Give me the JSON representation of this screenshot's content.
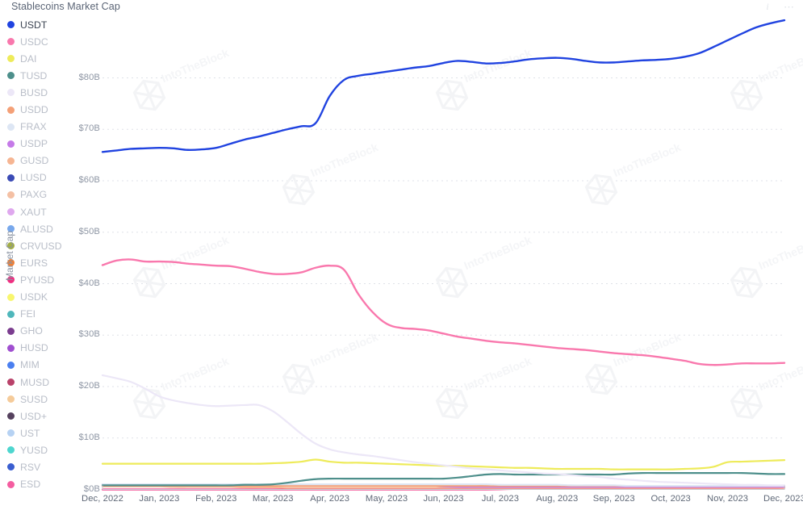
{
  "header": {
    "title": "Stablecoins Market Cap",
    "info_icon": "info-icon",
    "more_icon": "more-options-icon",
    "more_label": "⋯",
    "info_label": "i"
  },
  "watermark": {
    "text": "IntoTheBlock"
  },
  "legend": {
    "items": [
      {
        "label": "USDT",
        "color": "#2043e0",
        "active": true
      },
      {
        "label": "USDC",
        "color": "#f978ad",
        "active": false
      },
      {
        "label": "DAI",
        "color": "#eeeb5a",
        "active": false
      },
      {
        "label": "TUSD",
        "color": "#4d8f8b",
        "active": false
      },
      {
        "label": "BUSD",
        "color": "#ece7f7",
        "active": false
      },
      {
        "label": "USDD",
        "color": "#f4a077",
        "active": false
      },
      {
        "label": "FRAX",
        "color": "#dde6f4",
        "active": false
      },
      {
        "label": "USDP",
        "color": "#c57ae8",
        "active": false
      },
      {
        "label": "GUSD",
        "color": "#f6b592",
        "active": false
      },
      {
        "label": "LUSD",
        "color": "#3b4bb5",
        "active": false
      },
      {
        "label": "PAXG",
        "color": "#f4c0a4",
        "active": false
      },
      {
        "label": "XAUT",
        "color": "#dfa8ee",
        "active": false
      },
      {
        "label": "ALUSD",
        "color": "#78a8ec",
        "active": false
      },
      {
        "label": "CRVUSD",
        "color": "#a3ae46",
        "active": false
      },
      {
        "label": "EURS",
        "color": "#f07f35",
        "active": false
      },
      {
        "label": "PYUSD",
        "color": "#f02d80",
        "active": false
      },
      {
        "label": "USDK",
        "color": "#f8f66e",
        "active": false
      },
      {
        "label": "FEI",
        "color": "#4fb7bb",
        "active": false
      },
      {
        "label": "GHO",
        "color": "#7b3d8f",
        "active": false
      },
      {
        "label": "HUSD",
        "color": "#a04fd0",
        "active": false
      },
      {
        "label": "MIM",
        "color": "#4a7ff0",
        "active": false
      },
      {
        "label": "MUSD",
        "color": "#b9426a",
        "active": false
      },
      {
        "label": "SUSD",
        "color": "#f5cb9a",
        "active": false
      },
      {
        "label": "USD+",
        "color": "#55415e",
        "active": false
      },
      {
        "label": "UST",
        "color": "#b6d2f3",
        "active": false
      },
      {
        "label": "YUSD",
        "color": "#4ed6cf",
        "active": false
      },
      {
        "label": "RSV",
        "color": "#3a5ed0",
        "active": false
      },
      {
        "label": "ESD",
        "color": "#f45da0",
        "active": false
      }
    ]
  },
  "chart_data": {
    "type": "line",
    "title": "Stablecoins Market Cap",
    "xlabel": "",
    "ylabel": "Market Cap",
    "ylim": [
      0,
      85
    ],
    "yticks": [
      0,
      10,
      20,
      30,
      40,
      50,
      60,
      70,
      80
    ],
    "ytick_labels": [
      "$0B",
      "$10B",
      "$20B",
      "$30B",
      "$40B",
      "$50B",
      "$60B",
      "$70B",
      "$80B"
    ],
    "grid": true,
    "legend_position": "left",
    "unit": "billion USD",
    "categories": [
      "Dec, 2022",
      "Jan, 2023",
      "Feb, 2023",
      "Mar, 2023",
      "Apr, 2023",
      "May, 2023",
      "Jun, 2023",
      "Jul, 2023",
      "Aug, 2023",
      "Sep, 2023",
      "Oct, 2023",
      "Nov, 2023",
      "Dec, 2023"
    ],
    "x": [
      0,
      0.25,
      0.5,
      0.75,
      1,
      1.25,
      1.5,
      1.75,
      2,
      2.25,
      2.5,
      2.75,
      3,
      3.25,
      3.5,
      3.75,
      4,
      4.25,
      4.5,
      4.75,
      5,
      5.25,
      5.5,
      5.75,
      6,
      6.25,
      6.5,
      6.75,
      7,
      7.25,
      7.5,
      7.75,
      8,
      8.25,
      8.5,
      8.75,
      9,
      9.25,
      9.5,
      9.75,
      10,
      10.25,
      10.5,
      10.75,
      11,
      11.25,
      11.5,
      11.75,
      12
    ],
    "series": [
      {
        "name": "USDT",
        "color": "#2043e0",
        "values": [
          65.6,
          65.9,
          66.2,
          66.3,
          66.4,
          66.3,
          66.0,
          66.1,
          66.4,
          67.2,
          68.0,
          68.6,
          69.3,
          70.0,
          70.6,
          71.2,
          76.5,
          79.6,
          80.4,
          80.8,
          81.2,
          81.6,
          82.0,
          82.3,
          82.9,
          83.3,
          83.1,
          82.8,
          82.9,
          83.2,
          83.6,
          83.8,
          83.9,
          83.7,
          83.3,
          83.0,
          83.0,
          83.2,
          83.4,
          83.5,
          83.7,
          84.1,
          84.8,
          86.0,
          87.3,
          88.6,
          89.8,
          90.6,
          91.2
        ]
      },
      {
        "name": "USDC",
        "color": "#f978ad",
        "values": [
          43.6,
          44.5,
          44.7,
          44.3,
          44.3,
          44.2,
          43.9,
          43.7,
          43.5,
          43.4,
          42.9,
          42.3,
          41.9,
          41.9,
          42.2,
          43.1,
          43.5,
          42.7,
          38.0,
          34.5,
          32.2,
          31.4,
          31.2,
          30.9,
          30.3,
          29.7,
          29.3,
          28.9,
          28.6,
          28.4,
          28.1,
          27.8,
          27.5,
          27.3,
          27.1,
          26.8,
          26.5,
          26.3,
          26.1,
          25.8,
          25.4,
          25.0,
          24.4,
          24.2,
          24.3,
          24.5,
          24.5,
          24.5,
          24.6
        ]
      },
      {
        "name": "BUSD",
        "color": "#ece7f7",
        "values": [
          22.2,
          21.6,
          20.9,
          19.6,
          18.1,
          17.3,
          16.8,
          16.4,
          16.2,
          16.3,
          16.4,
          16.4,
          15.2,
          13.1,
          10.8,
          8.9,
          7.8,
          7.2,
          6.8,
          6.5,
          6.1,
          5.7,
          5.3,
          5.0,
          4.7,
          4.4,
          4.1,
          3.9,
          3.7,
          3.5,
          3.3,
          3.1,
          3.0,
          2.8,
          2.6,
          2.4,
          2.1,
          1.9,
          1.7,
          1.5,
          1.4,
          1.3,
          1.2,
          1.1,
          1.0,
          0.9,
          0.9,
          0.8,
          0.8
        ]
      },
      {
        "name": "DAI",
        "color": "#eeeb5a",
        "values": [
          5.0,
          5.0,
          5.0,
          5.0,
          5.0,
          5.0,
          5.0,
          5.0,
          5.0,
          5.0,
          5.0,
          5.0,
          5.1,
          5.2,
          5.4,
          5.8,
          5.4,
          5.2,
          5.2,
          5.1,
          5.0,
          4.9,
          4.8,
          4.7,
          4.6,
          4.6,
          4.5,
          4.4,
          4.3,
          4.2,
          4.2,
          4.1,
          4.0,
          4.0,
          4.0,
          4.0,
          3.9,
          3.9,
          3.9,
          3.9,
          3.9,
          4.0,
          4.1,
          4.4,
          5.3,
          5.4,
          5.5,
          5.6,
          5.7
        ]
      },
      {
        "name": "TUSD",
        "color": "#4d8f8b",
        "values": [
          0.8,
          0.8,
          0.8,
          0.8,
          0.8,
          0.8,
          0.8,
          0.8,
          0.8,
          0.8,
          0.9,
          0.9,
          1.0,
          1.3,
          1.7,
          2.0,
          2.1,
          2.1,
          2.1,
          2.1,
          2.1,
          2.1,
          2.1,
          2.1,
          2.1,
          2.3,
          2.6,
          2.9,
          3.0,
          2.9,
          2.9,
          2.9,
          2.9,
          2.9,
          2.9,
          2.9,
          2.9,
          3.1,
          3.2,
          3.2,
          3.2,
          3.2,
          3.2,
          3.2,
          3.2,
          3.2,
          3.1,
          3.0,
          3.0
        ]
      },
      {
        "name": "FRAX",
        "color": "#dde6f4",
        "values": [
          1.0,
          1.0,
          1.0,
          1.0,
          1.0,
          1.0,
          1.0,
          1.0,
          1.0,
          1.0,
          1.0,
          1.0,
          1.0,
          1.0,
          1.0,
          1.0,
          1.0,
          1.0,
          1.0,
          1.0,
          1.0,
          1.0,
          1.0,
          1.0,
          1.0,
          1.0,
          1.0,
          1.0,
          0.9,
          0.9,
          0.9,
          0.9,
          0.9,
          0.8,
          0.8,
          0.8,
          0.8,
          0.7,
          0.7,
          0.7,
          0.7,
          0.7,
          0.7,
          0.7,
          0.7,
          0.7,
          0.7,
          0.7,
          0.7
        ]
      },
      {
        "name": "USDD",
        "color": "#f4a077",
        "values": [
          0.7,
          0.7,
          0.7,
          0.7,
          0.7,
          0.7,
          0.7,
          0.7,
          0.7,
          0.7,
          0.7,
          0.7,
          0.7,
          0.7,
          0.7,
          0.7,
          0.7,
          0.7,
          0.7,
          0.7,
          0.7,
          0.7,
          0.7,
          0.7,
          0.7,
          0.7,
          0.7,
          0.7,
          0.7,
          0.7,
          0.7,
          0.7,
          0.7,
          0.7,
          0.7,
          0.7,
          0.7,
          0.7,
          0.7,
          0.7,
          0.7,
          0.7,
          0.7,
          0.7,
          0.7,
          0.7,
          0.7,
          0.7,
          0.7
        ]
      },
      {
        "name": "USDP",
        "color": "#c57ae8",
        "values": [
          1.0,
          1.0,
          1.0,
          1.0,
          1.0,
          1.0,
          1.0,
          1.0,
          1.0,
          1.0,
          1.0,
          1.0,
          1.0,
          1.0,
          1.0,
          0.9,
          0.9,
          0.9,
          0.9,
          0.9,
          0.9,
          0.9,
          0.8,
          0.8,
          0.6,
          0.5,
          0.5,
          0.5,
          0.5,
          0.5,
          0.5,
          0.5,
          0.5,
          0.5,
          0.5,
          0.5,
          0.5,
          0.5,
          0.5,
          0.5,
          0.5,
          0.5,
          0.5,
          0.5,
          0.5,
          0.5,
          0.5,
          0.5,
          0.5
        ]
      },
      {
        "name": "GUSD",
        "color": "#f6b592",
        "values": [
          0.6,
          0.6,
          0.6,
          0.6,
          0.6,
          0.5,
          0.5,
          0.5,
          0.5,
          0.5,
          0.4,
          0.4,
          0.4,
          0.3,
          0.3,
          0.3,
          0.3,
          0.3,
          0.3,
          0.3,
          0.3,
          0.3,
          0.3,
          0.3,
          0.3,
          0.3,
          0.3,
          0.3,
          0.3,
          0.3,
          0.3,
          0.3,
          0.3,
          0.3,
          0.3,
          0.3,
          0.3,
          0.3,
          0.3,
          0.3,
          0.3,
          0.3,
          0.3,
          0.3,
          0.3,
          0.3,
          0.3,
          0.3,
          0.3
        ]
      },
      {
        "name": "PYUSD",
        "color": "#f02d80",
        "values": [
          0,
          0,
          0,
          0,
          0,
          0,
          0,
          0,
          0,
          0,
          0,
          0,
          0,
          0,
          0,
          0,
          0,
          0,
          0,
          0,
          0,
          0,
          0,
          0,
          0,
          0,
          0,
          0,
          0.04,
          0.1,
          0.2,
          0.2,
          0.2,
          0.2,
          0.2,
          0.2,
          0.2,
          0.2,
          0.2,
          0.2,
          0.2,
          0.2,
          0.2,
          0.2,
          0.2,
          0.2,
          0.2,
          0.2,
          0.3
        ]
      }
    ]
  }
}
